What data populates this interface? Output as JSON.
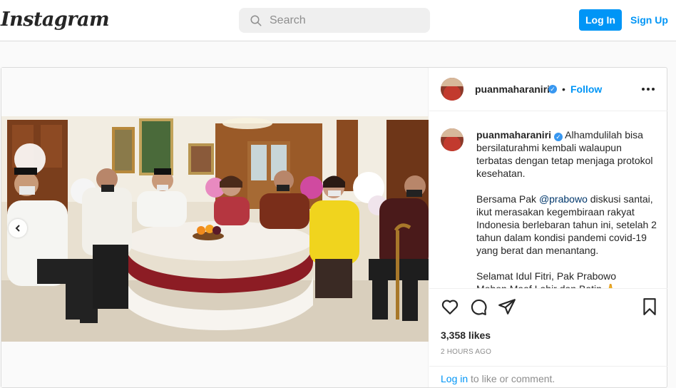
{
  "header": {
    "logo": "Instagram",
    "search_placeholder": "Search",
    "login_label": "Log In",
    "signup_label": "Sign Up"
  },
  "post": {
    "username": "puanmaharaniri",
    "follow_label": "Follow",
    "dot": "•",
    "caption": {
      "username": "puanmaharaniri",
      "line1": " Alhamdulilah bisa bersilaturahmi kembali walaupun terbatas dengan tetap menjaga protokol kesehatan.",
      "para2_prefix": "Bersama Pak ",
      "mention": "@prabowo",
      "para2_suffix": " diskusi santai, ikut merasakan kegembiraan rakyat Indonesia berlebaran tahun ini, setelah 2 tahun dalam kondisi pandemi covid-19 yang berat dan menantang.",
      "para3": "Selamat Idul Fitri, Pak Prabowo",
      "para4": "Mohon Maaf Lahir dan Batin 🙏"
    },
    "likes": "3,358 likes",
    "time": "2 HOURS AGO",
    "login_link": "Log in",
    "login_suffix": " to like or comment."
  },
  "icons": {
    "search": "search-icon",
    "prev": "chevron-left-icon",
    "like": "heart-icon",
    "comment": "comment-icon",
    "share": "share-icon",
    "save": "bookmark-icon",
    "more": "more-options-icon",
    "verified": "verified-badge-icon"
  },
  "colors": {
    "accent": "#0095f6",
    "verified": "#3897f0",
    "text": "#262626",
    "muted": "#8e8e8e"
  }
}
